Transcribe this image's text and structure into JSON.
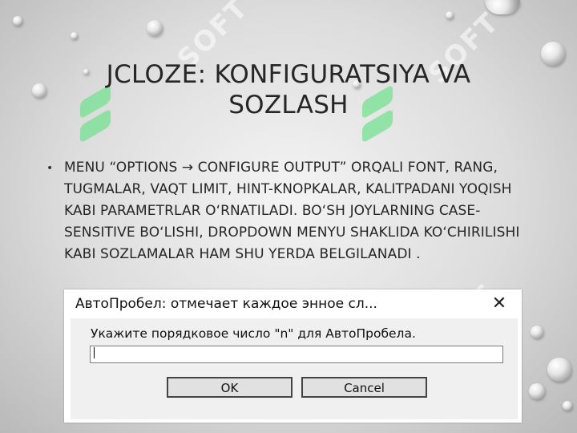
{
  "slide": {
    "title": "JCLOZE: KONFIGURATSIYA VA SOZLASH",
    "bullets": [
      "MENU “OPTIONS → CONFIGURE OUTPUT” ORQALI FONT, RANG, TUGMALAR, VAQT LIMIT, HINT-KNOPKALAR, KALITPADANI YOQISH KABI PARAMETRLAR O‘RNATILADI. BO‘SH JOYLARNING CASE-SENSITIVE BO‘LISHI, DROPDOWN MENYU SHAKLIDA KO‘CHIRILISHI KABI SOZLAMALAR HAM SHU YERDA BELGILANADI ."
    ]
  },
  "dialog": {
    "title": "АвтоПробел: отмечает каждое энное сл...",
    "close_glyph": "✕",
    "prompt": "Укажите порядковое число \"n\" для АвтоПробела.",
    "input_value": "",
    "ok_label": "OK",
    "cancel_label": "Cancel"
  },
  "watermark": {
    "text": "SOFT"
  }
}
